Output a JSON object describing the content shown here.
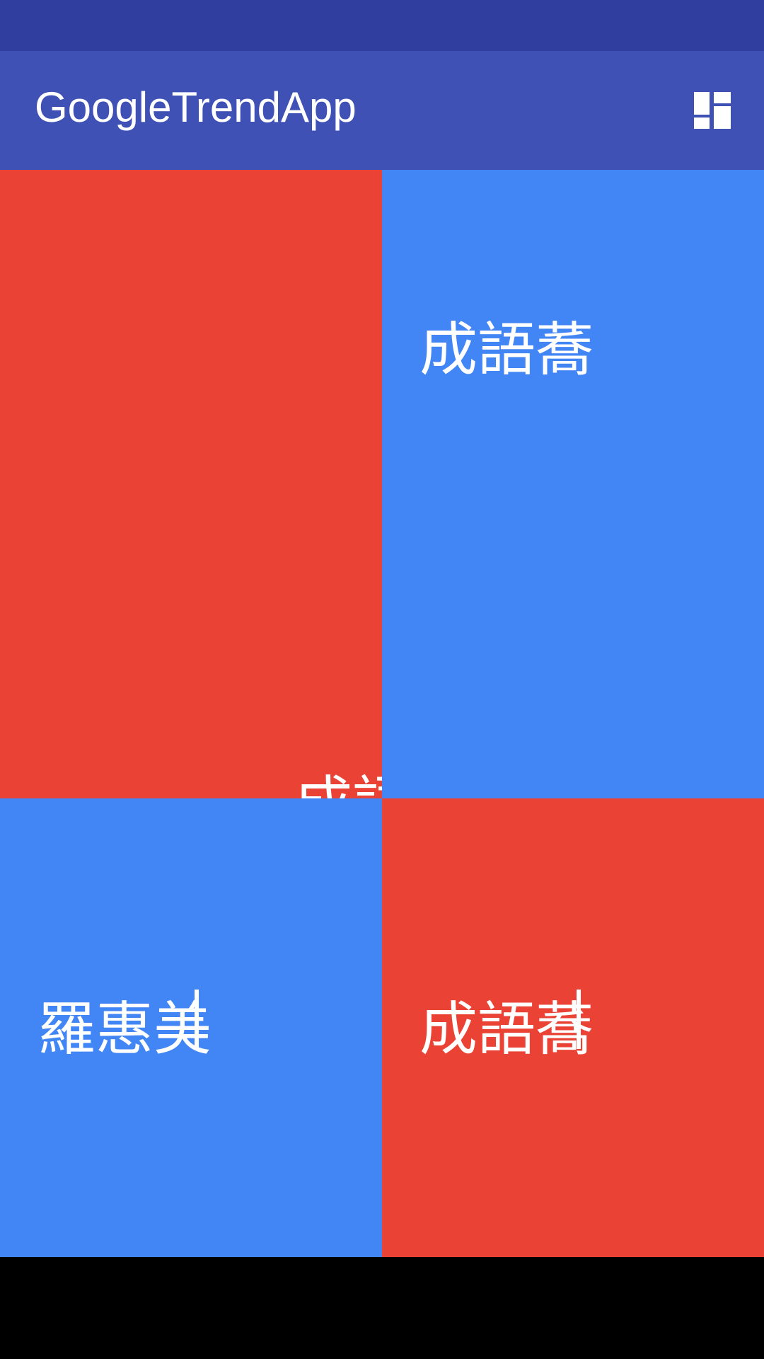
{
  "status_bar": {
    "color": "#303F9F"
  },
  "app_bar": {
    "color": "#3F51B5",
    "title": "GoogleTrendApp",
    "action_icon": "dashboard-layout-icon"
  },
  "tiles": [
    {
      "label": "成語蕎",
      "color": "#EA4335"
    },
    {
      "label": "成語蕎",
      "color": "#4285F4"
    },
    {
      "label": "羅惠美",
      "color": "#4285F4"
    },
    {
      "label": "成語蕎",
      "color": "#EA4335"
    }
  ],
  "nav_bar": {
    "color": "#000000"
  }
}
